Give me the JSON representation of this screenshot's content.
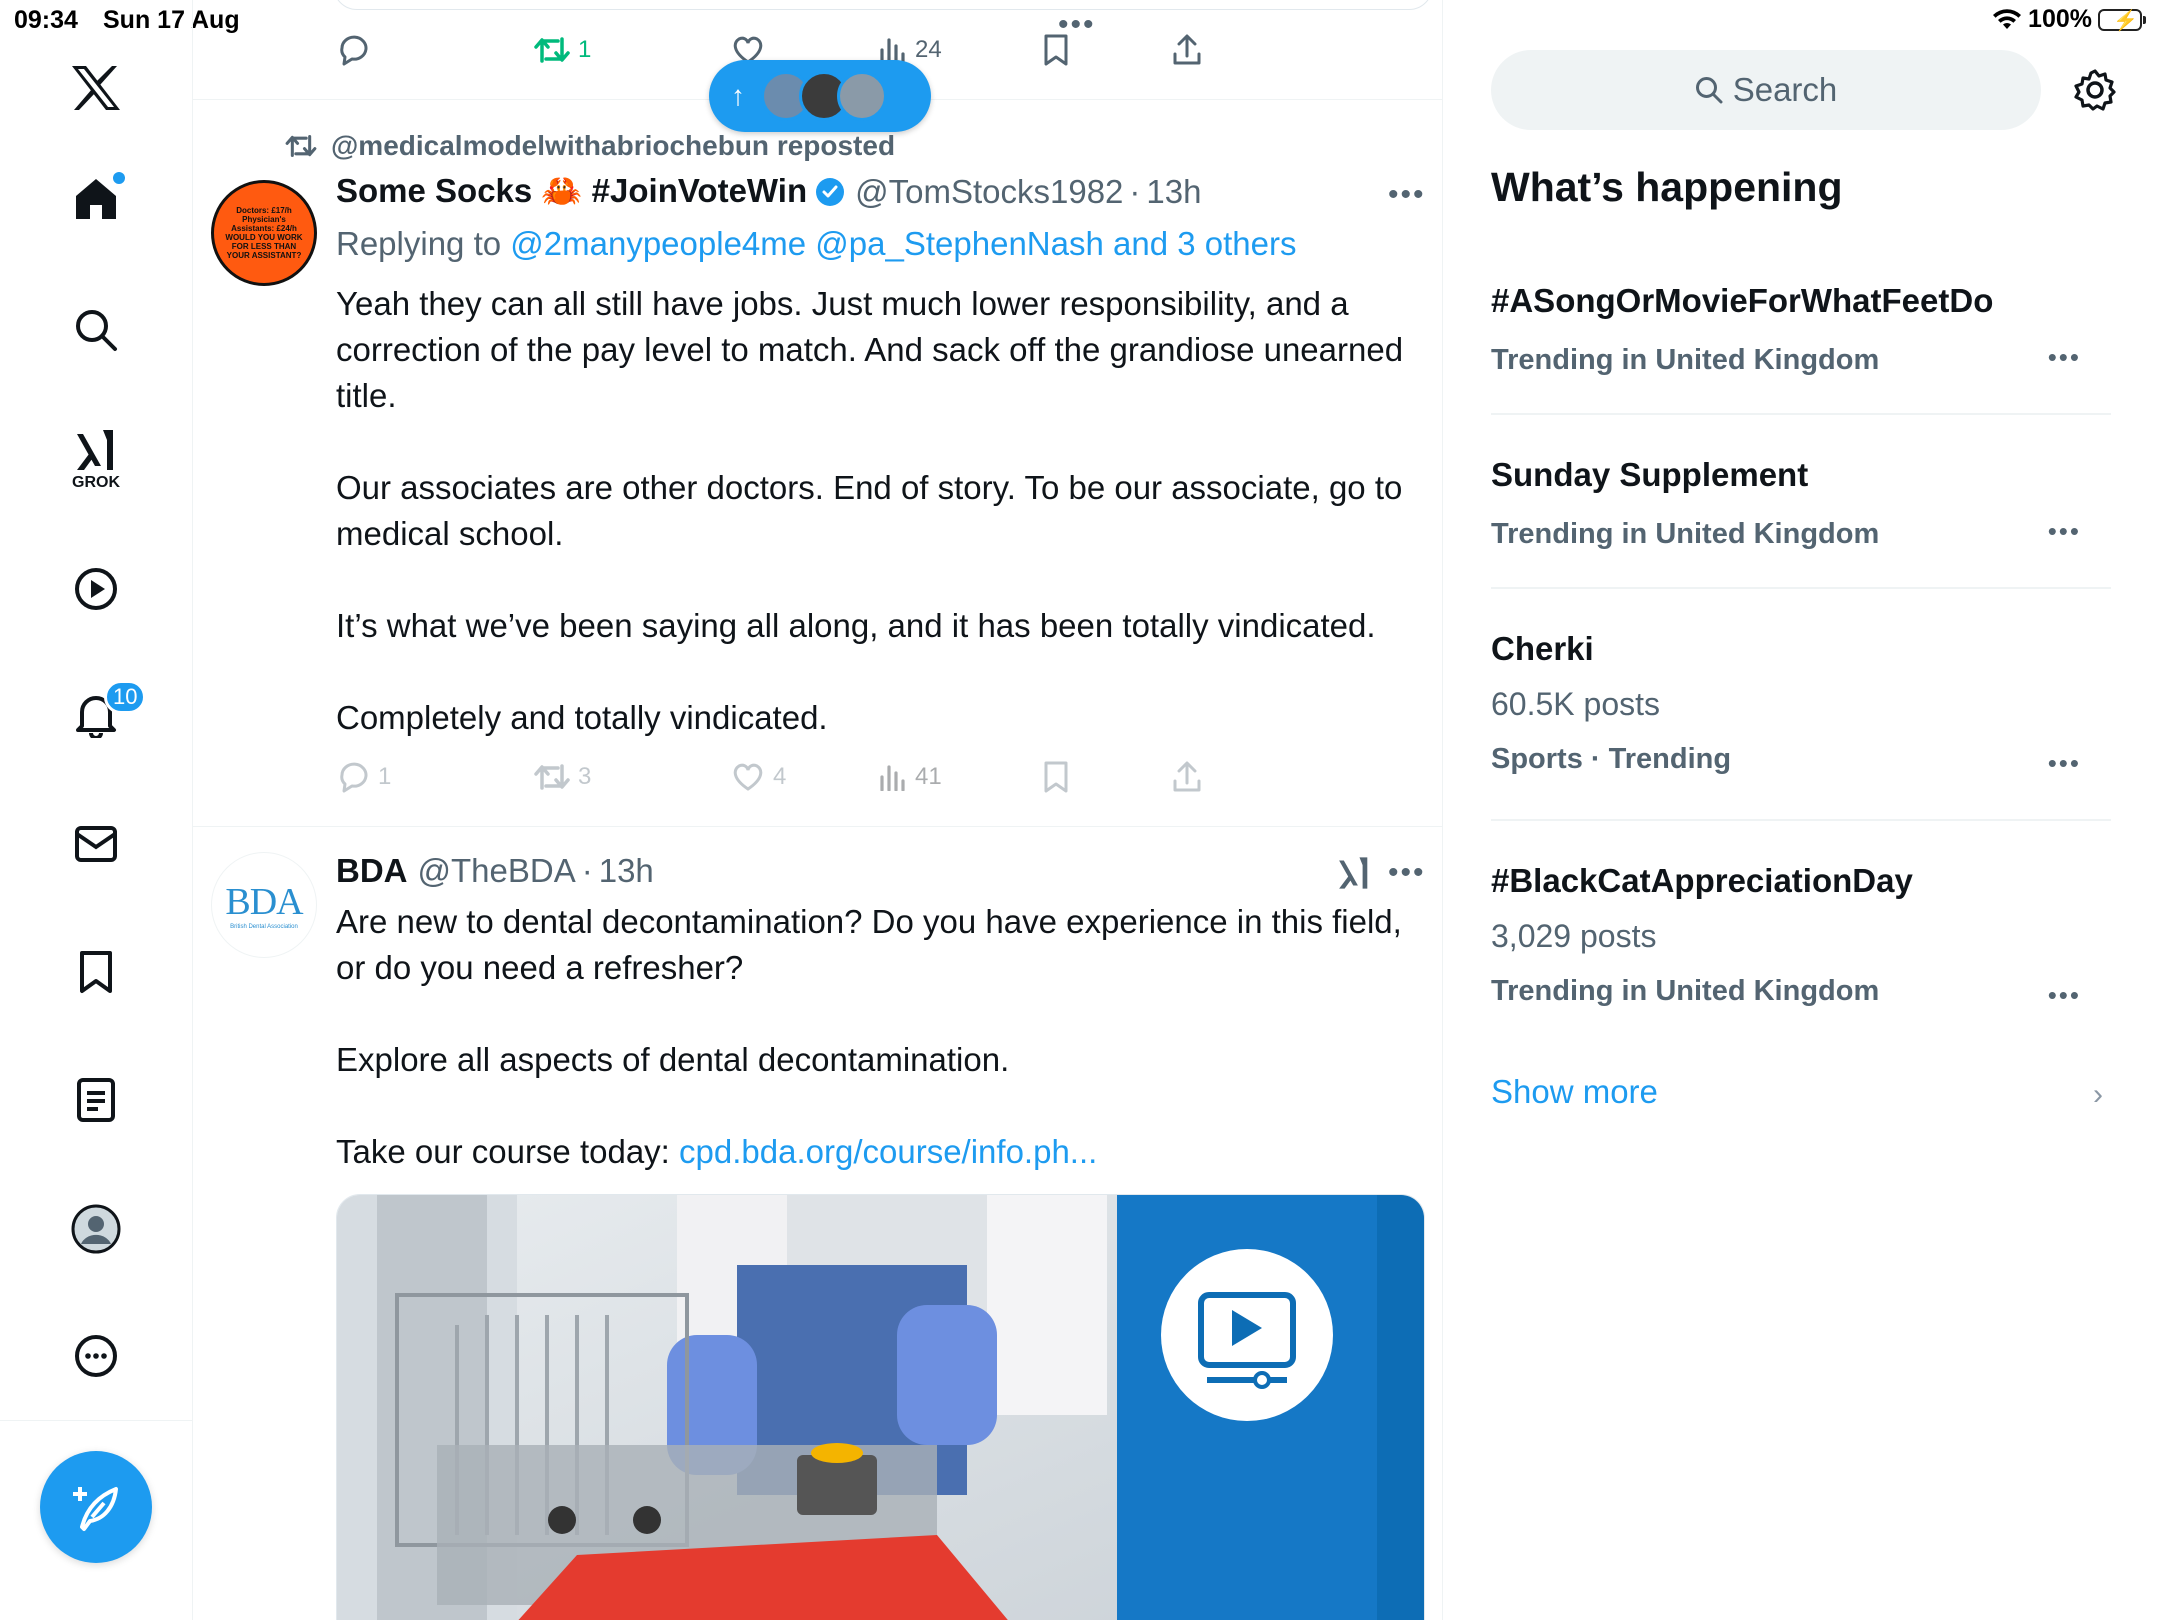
{
  "status_bar": {
    "time": "09:34",
    "date": "Sun 17 Aug",
    "battery": "100%"
  },
  "nav": {
    "grok_label": "GROK",
    "notifications_badge": "10"
  },
  "prev_post_actions": {
    "reposts": "1",
    "views": "24"
  },
  "reposted_by": "@medicalmodelwithabriochebun reposted",
  "post1": {
    "avatar_text": [
      "Doctors: £17/h",
      "Physician's",
      "Assistants: £24/h",
      "WOULD YOU WORK",
      "FOR LESS THAN",
      "YOUR ASSISTANT?"
    ],
    "name": "Some Socks 🦀 #JoinVoteWin",
    "handle": "@TomStocks1982",
    "sep": "·",
    "time": "13h",
    "replying_prefix": "Replying to",
    "replying_to": "@2manypeople4me @pa_StephenNash and 3 others",
    "paragraphs": [
      "Yeah they can all still have jobs. Just much lower responsibility, and a correction of the pay level to match. And sack off the grandiose unearned title.",
      "Our associates are other doctors. End of story. To be our associate, go to medical school.",
      "It’s what we’ve been saying all along, and it has been totally vindicated.",
      "Completely and totally vindicated."
    ],
    "actions": {
      "replies": "1",
      "reposts": "3",
      "likes": "4",
      "views": "41"
    }
  },
  "post2": {
    "avatar_logo": "BDA",
    "avatar_sub": "British Dental Association",
    "name": "BDA",
    "handle": "@TheBDA",
    "sep": "·",
    "time": "13h",
    "paragraphs": [
      "Are new to dental decontamination? Do you have experience in this field, or do you need a refresher?",
      "Explore all aspects of dental decontamination."
    ],
    "cta_prefix": "Take our course today: ",
    "cta_link": "cpd.bda.org/course/info.ph..."
  },
  "right": {
    "search_placeholder": "Search",
    "section_title": "What’s happening",
    "trends": [
      {
        "name": "#ASongOrMovieForWhatFeetDo",
        "count": "",
        "context": "Trending in United Kingdom"
      },
      {
        "name": "Sunday Supplement",
        "count": "",
        "context": "Trending in United Kingdom"
      },
      {
        "name": "Cherki",
        "count": "60.5K posts",
        "context": "Sports · Trending"
      },
      {
        "name": "#BlackCatAppreciationDay",
        "count": "3,029 posts",
        "context": "Trending in United Kingdom"
      }
    ],
    "show_more": "Show more"
  },
  "colors": {
    "accent": "#1d9bf0",
    "repost_green": "#00ba7c",
    "secondary_text": "#536471"
  }
}
